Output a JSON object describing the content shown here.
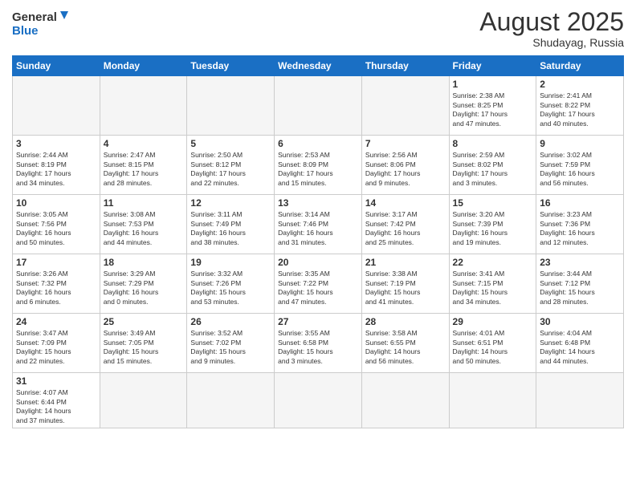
{
  "header": {
    "logo_general": "General",
    "logo_blue": "Blue",
    "month_year": "August 2025",
    "location": "Shudayag, Russia"
  },
  "weekdays": [
    "Sunday",
    "Monday",
    "Tuesday",
    "Wednesday",
    "Thursday",
    "Friday",
    "Saturday"
  ],
  "weeks": [
    [
      {
        "day": "",
        "info": ""
      },
      {
        "day": "",
        "info": ""
      },
      {
        "day": "",
        "info": ""
      },
      {
        "day": "",
        "info": ""
      },
      {
        "day": "",
        "info": ""
      },
      {
        "day": "1",
        "info": "Sunrise: 2:38 AM\nSunset: 8:25 PM\nDaylight: 17 hours\nand 47 minutes."
      },
      {
        "day": "2",
        "info": "Sunrise: 2:41 AM\nSunset: 8:22 PM\nDaylight: 17 hours\nand 40 minutes."
      }
    ],
    [
      {
        "day": "3",
        "info": "Sunrise: 2:44 AM\nSunset: 8:19 PM\nDaylight: 17 hours\nand 34 minutes."
      },
      {
        "day": "4",
        "info": "Sunrise: 2:47 AM\nSunset: 8:15 PM\nDaylight: 17 hours\nand 28 minutes."
      },
      {
        "day": "5",
        "info": "Sunrise: 2:50 AM\nSunset: 8:12 PM\nDaylight: 17 hours\nand 22 minutes."
      },
      {
        "day": "6",
        "info": "Sunrise: 2:53 AM\nSunset: 8:09 PM\nDaylight: 17 hours\nand 15 minutes."
      },
      {
        "day": "7",
        "info": "Sunrise: 2:56 AM\nSunset: 8:06 PM\nDaylight: 17 hours\nand 9 minutes."
      },
      {
        "day": "8",
        "info": "Sunrise: 2:59 AM\nSunset: 8:02 PM\nDaylight: 17 hours\nand 3 minutes."
      },
      {
        "day": "9",
        "info": "Sunrise: 3:02 AM\nSunset: 7:59 PM\nDaylight: 16 hours\nand 56 minutes."
      }
    ],
    [
      {
        "day": "10",
        "info": "Sunrise: 3:05 AM\nSunset: 7:56 PM\nDaylight: 16 hours\nand 50 minutes."
      },
      {
        "day": "11",
        "info": "Sunrise: 3:08 AM\nSunset: 7:53 PM\nDaylight: 16 hours\nand 44 minutes."
      },
      {
        "day": "12",
        "info": "Sunrise: 3:11 AM\nSunset: 7:49 PM\nDaylight: 16 hours\nand 38 minutes."
      },
      {
        "day": "13",
        "info": "Sunrise: 3:14 AM\nSunset: 7:46 PM\nDaylight: 16 hours\nand 31 minutes."
      },
      {
        "day": "14",
        "info": "Sunrise: 3:17 AM\nSunset: 7:42 PM\nDaylight: 16 hours\nand 25 minutes."
      },
      {
        "day": "15",
        "info": "Sunrise: 3:20 AM\nSunset: 7:39 PM\nDaylight: 16 hours\nand 19 minutes."
      },
      {
        "day": "16",
        "info": "Sunrise: 3:23 AM\nSunset: 7:36 PM\nDaylight: 16 hours\nand 12 minutes."
      }
    ],
    [
      {
        "day": "17",
        "info": "Sunrise: 3:26 AM\nSunset: 7:32 PM\nDaylight: 16 hours\nand 6 minutes."
      },
      {
        "day": "18",
        "info": "Sunrise: 3:29 AM\nSunset: 7:29 PM\nDaylight: 16 hours\nand 0 minutes."
      },
      {
        "day": "19",
        "info": "Sunrise: 3:32 AM\nSunset: 7:26 PM\nDaylight: 15 hours\nand 53 minutes."
      },
      {
        "day": "20",
        "info": "Sunrise: 3:35 AM\nSunset: 7:22 PM\nDaylight: 15 hours\nand 47 minutes."
      },
      {
        "day": "21",
        "info": "Sunrise: 3:38 AM\nSunset: 7:19 PM\nDaylight: 15 hours\nand 41 minutes."
      },
      {
        "day": "22",
        "info": "Sunrise: 3:41 AM\nSunset: 7:15 PM\nDaylight: 15 hours\nand 34 minutes."
      },
      {
        "day": "23",
        "info": "Sunrise: 3:44 AM\nSunset: 7:12 PM\nDaylight: 15 hours\nand 28 minutes."
      }
    ],
    [
      {
        "day": "24",
        "info": "Sunrise: 3:47 AM\nSunset: 7:09 PM\nDaylight: 15 hours\nand 22 minutes."
      },
      {
        "day": "25",
        "info": "Sunrise: 3:49 AM\nSunset: 7:05 PM\nDaylight: 15 hours\nand 15 minutes."
      },
      {
        "day": "26",
        "info": "Sunrise: 3:52 AM\nSunset: 7:02 PM\nDaylight: 15 hours\nand 9 minutes."
      },
      {
        "day": "27",
        "info": "Sunrise: 3:55 AM\nSunset: 6:58 PM\nDaylight: 15 hours\nand 3 minutes."
      },
      {
        "day": "28",
        "info": "Sunrise: 3:58 AM\nSunset: 6:55 PM\nDaylight: 14 hours\nand 56 minutes."
      },
      {
        "day": "29",
        "info": "Sunrise: 4:01 AM\nSunset: 6:51 PM\nDaylight: 14 hours\nand 50 minutes."
      },
      {
        "day": "30",
        "info": "Sunrise: 4:04 AM\nSunset: 6:48 PM\nDaylight: 14 hours\nand 44 minutes."
      }
    ],
    [
      {
        "day": "31",
        "info": "Sunrise: 4:07 AM\nSunset: 6:44 PM\nDaylight: 14 hours\nand 37 minutes."
      },
      {
        "day": "",
        "info": ""
      },
      {
        "day": "",
        "info": ""
      },
      {
        "day": "",
        "info": ""
      },
      {
        "day": "",
        "info": ""
      },
      {
        "day": "",
        "info": ""
      },
      {
        "day": "",
        "info": ""
      }
    ]
  ]
}
